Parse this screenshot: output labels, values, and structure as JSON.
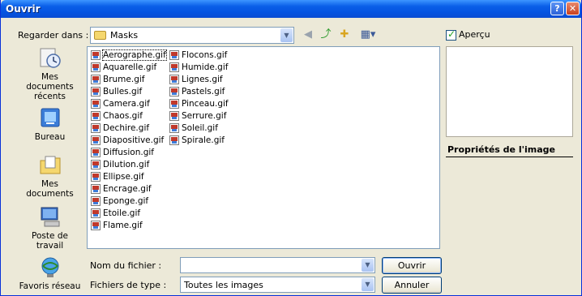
{
  "window": {
    "title": "Ouvrir"
  },
  "titlebar": {
    "help": "?",
    "close": "✕"
  },
  "look_in": {
    "label": "Regarder dans :",
    "value": "Masks"
  },
  "toolbar": {
    "icons": [
      "back-icon",
      "up-folder-icon",
      "new-folder-icon",
      "view-menu-icon"
    ]
  },
  "places": [
    {
      "label": "Mes documents récents",
      "icon": "recent-documents-icon"
    },
    {
      "label": "Bureau",
      "icon": "desktop-icon"
    },
    {
      "label": "Mes documents",
      "icon": "my-documents-icon"
    },
    {
      "label": "Poste de travail",
      "icon": "my-computer-icon"
    },
    {
      "label": "Favoris réseau",
      "icon": "network-places-icon"
    }
  ],
  "files": [
    "Aerographe.gif",
    "Aquarelle.gif",
    "Brume.gif",
    "Bulles.gif",
    "Camera.gif",
    "Chaos.gif",
    "Dechire.gif",
    "Diapositive.gif",
    "Diffusion.gif",
    "Dilution.gif",
    "Ellipse.gif",
    "Encrage.gif",
    "Eponge.gif",
    "Etoile.gif",
    "Flame.gif",
    "Flocons.gif",
    "Humide.gif",
    "Lignes.gif",
    "Pastels.gif",
    "Pinceau.gif",
    "Serrure.gif",
    "Soleil.gif",
    "Spirale.gif"
  ],
  "filename": {
    "label": "Nom du fichier :",
    "value": ""
  },
  "filetype": {
    "label": "Fichiers de type :",
    "value": "Toutes les images"
  },
  "buttons": {
    "open": "Ouvrir",
    "cancel": "Annuler"
  },
  "preview": {
    "label": "Aperçu",
    "checked": true,
    "properties_title": "Propriétés de l'image"
  },
  "colors": {
    "titlebar": "#0553e1",
    "dialog_bg": "#ece9d8",
    "close": "#c8411f"
  }
}
